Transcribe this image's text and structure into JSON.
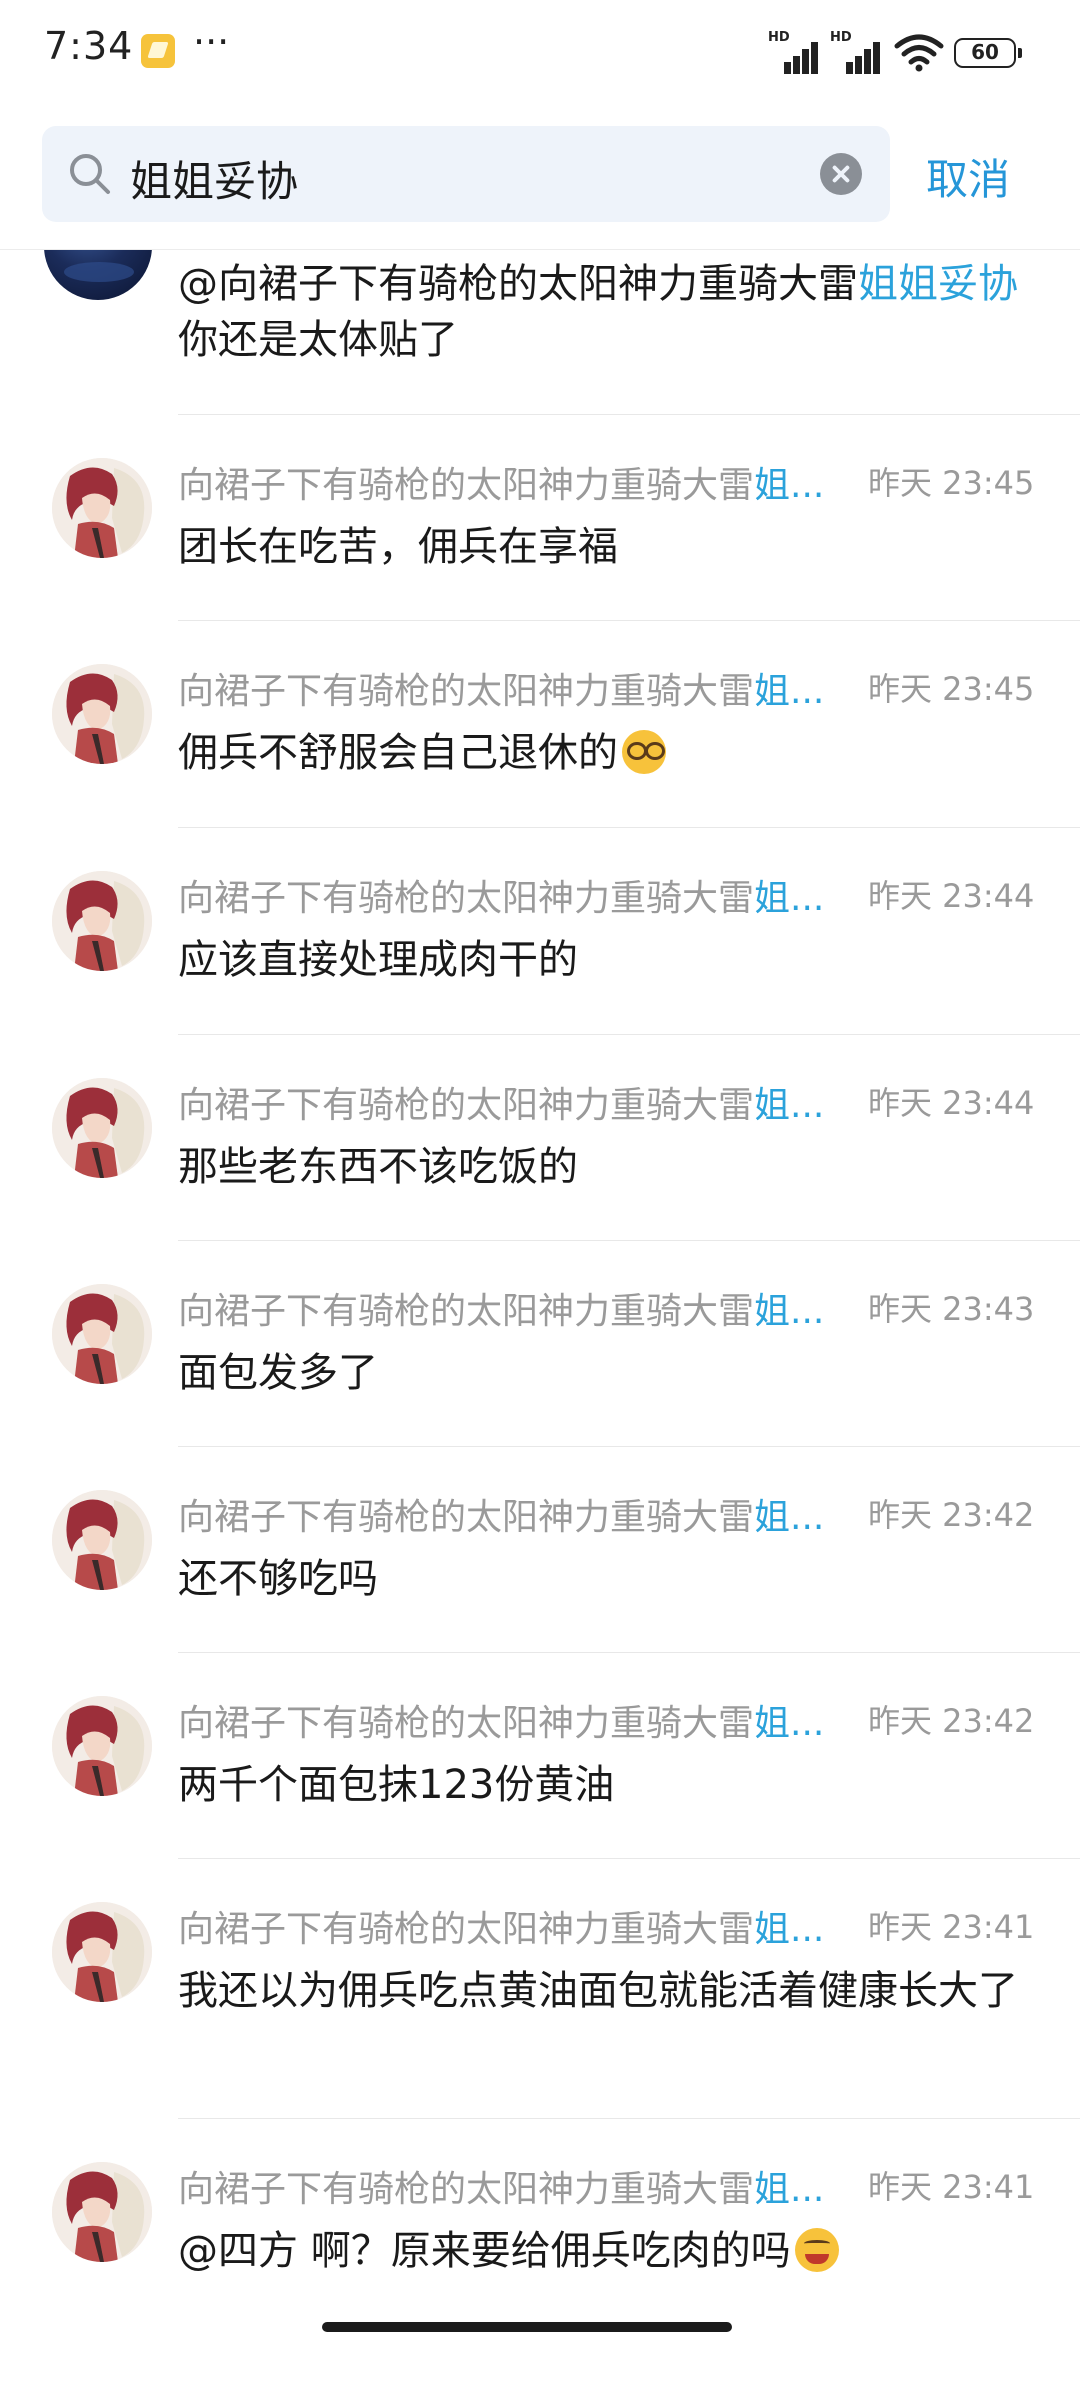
{
  "status_bar": {
    "time": "7:34",
    "more": "···",
    "signal1_label": "HD",
    "signal2_label": "HD",
    "battery": "60"
  },
  "search": {
    "query": "姐姐妥协",
    "cancel_label": "取消"
  },
  "colors": {
    "accent": "#2596d8",
    "keyword": "#2ba2db",
    "meta": "#9a9a9a"
  },
  "first_message": {
    "prefix": "@向裙子下有骑枪的太阳神力重骑大雷",
    "keyword": "姐姐妥协",
    "suffix": "  你还是太体贴了"
  },
  "messages": [
    {
      "name": "向裙子下有骑枪的太阳神力重骑大雷",
      "keyword": "姐...",
      "time": "昨天 23:45",
      "text": "团长在吃苦，佣兵在享福",
      "emoji": ""
    },
    {
      "name": "向裙子下有骑枪的太阳神力重骑大雷",
      "keyword": "姐...",
      "time": "昨天 23:45",
      "text": "佣兵不舒服会自己退休的",
      "emoji": "nerd-face-emoji"
    },
    {
      "name": "向裙子下有骑枪的太阳神力重骑大雷",
      "keyword": "姐...",
      "time": "昨天 23:44",
      "text": "应该直接处理成肉干的",
      "emoji": ""
    },
    {
      "name": "向裙子下有骑枪的太阳神力重骑大雷",
      "keyword": "姐...",
      "time": "昨天 23:44",
      "text": "那些老东西不该吃饭的",
      "emoji": ""
    },
    {
      "name": "向裙子下有骑枪的太阳神力重骑大雷",
      "keyword": "姐...",
      "time": "昨天 23:43",
      "text": "面包发多了",
      "emoji": ""
    },
    {
      "name": "向裙子下有骑枪的太阳神力重骑大雷",
      "keyword": "姐...",
      "time": "昨天 23:42",
      "text": "还不够吃吗",
      "emoji": ""
    },
    {
      "name": "向裙子下有骑枪的太阳神力重骑大雷",
      "keyword": "姐...",
      "time": "昨天 23:42",
      "text": "两千个面包抹123份黄油",
      "emoji": ""
    },
    {
      "name": "向裙子下有骑枪的太阳神力重骑大雷",
      "keyword": "姐...",
      "time": "昨天 23:41",
      "text": "我还以为佣兵吃点黄油面包就能活着健康长大了",
      "emoji": ""
    },
    {
      "name": "向裙子下有骑枪的太阳神力重骑大雷",
      "keyword": "姐...",
      "time": "昨天 23:41",
      "text": "@四方 啊？原来要给佣兵吃肉的吗",
      "emoji": "laughing-emoji"
    }
  ]
}
